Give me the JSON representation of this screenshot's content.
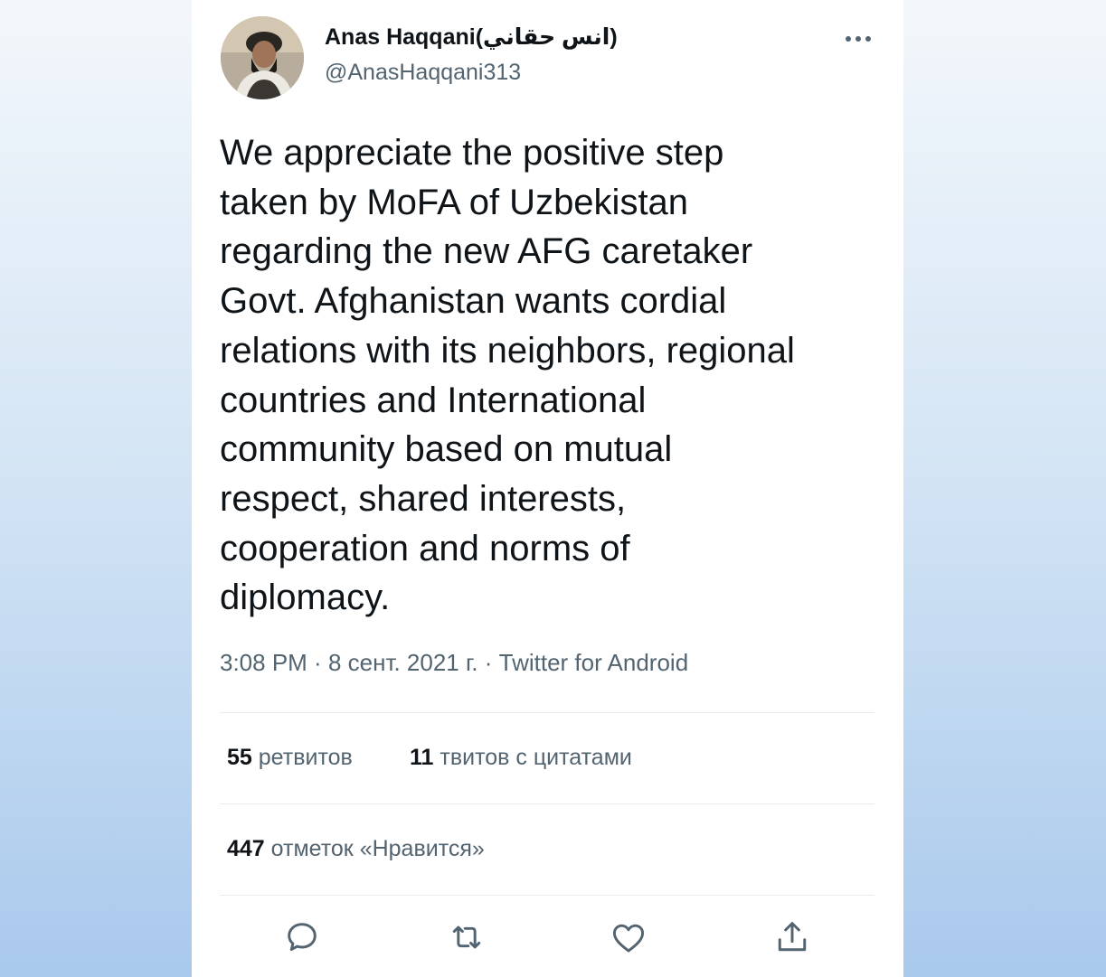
{
  "author": {
    "display_name": "Anas Haqqani(انس حقاني)",
    "handle": "@AnasHaqqani313"
  },
  "tweet": {
    "text": "We appreciate the positive step taken by MoFA of Uzbekistan regarding the new AFG caretaker Govt. Afghanistan wants cordial relations with its neighbors, regional countries and International community based on mutual respect, shared interests, cooperation and norms of diplomacy.",
    "lines": [
      "We appreciate the positive step",
      "taken by MoFA of Uzbekistan",
      "regarding the new AFG caretaker",
      "Govt. Afghanistan wants cordial",
      "relations with its neighbors, regional",
      "countries and International",
      "community based on mutual",
      "respect, shared interests,",
      "cooperation and norms of",
      "diplomacy."
    ],
    "time": "3:08 PM",
    "date": "8 сент. 2021 г.",
    "source": "Twitter for Android",
    "separator": " · "
  },
  "stats": {
    "retweets_count": "55",
    "retweets_label": "ретвитов",
    "quotes_count": "11",
    "quotes_label": "твитов с цитатами",
    "likes_count": "447",
    "likes_label": "отметок «Нравится»"
  },
  "icons": {
    "more": "more-horizontal-icon",
    "reply": "reply-icon",
    "retweet": "retweet-icon",
    "like": "heart-icon",
    "share": "share-icon"
  },
  "colors": {
    "text_primary": "#0f1419",
    "text_secondary": "#536471",
    "divider": "#e6ecf0",
    "icon": "#536471"
  }
}
